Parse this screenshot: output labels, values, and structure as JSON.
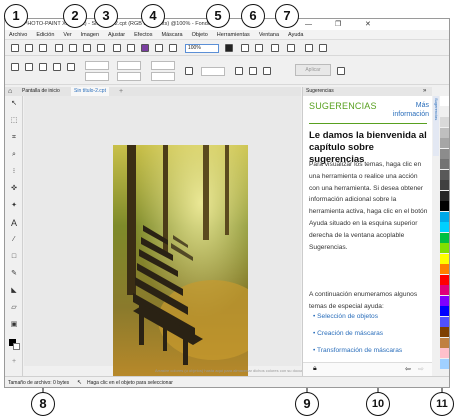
{
  "window": {
    "title": "Corel PHOTO-PAINT X8 (64Bit) - Sin título-2.cpt (RGB de 24 bits) @100% - Fondo"
  },
  "menu": [
    "Archivo",
    "Edición",
    "Ver",
    "Imagen",
    "Ajustar",
    "Efectos",
    "Máscara",
    "Objeto",
    "Herramientas",
    "Ventana",
    "Ayuda"
  ],
  "toolbar": {
    "zoom_value": "100%",
    "apply_label": "Aplicar"
  },
  "tabs": [
    {
      "label": "Pantalla de inicio"
    },
    {
      "label": "Sin título-2.cpt"
    }
  ],
  "canvas": {
    "hint": "Arrastre colores (u objetos) hasta aquí para almacenar dichos colores con su documento"
  },
  "docker": {
    "header": "Sugerencias",
    "section": "SUGERENCIAS",
    "more_info": "Más información",
    "title": "Le damos la bienvenida al capítulo sobre sugerencias",
    "body": "Para visualizar los temas, haga clic en una herramienta o realice una acción con una herramienta. Si desea obtener información adicional sobre la herramienta activa, haga clic en el botón Ayuda situado en la esquina superior derecha de la ventana acoplable Sugerencias.",
    "intro": "A continuación enumeramos algunos temas de especial ayuda:",
    "links": [
      "Selección de objetos",
      "Creación de máscaras",
      "Transformación de máscaras"
    ]
  },
  "vertical_tab": "Sugerencias",
  "status": {
    "size": "Tamaño de archivo: 0 bytes",
    "message": "Haga clic en el objeto para seleccionar"
  },
  "palette_colors": [
    "#ffffff",
    "#f0f0f0",
    "#d9d9d9",
    "#bfbfbf",
    "#a6a6a6",
    "#8c8c8c",
    "#737373",
    "#595959",
    "#404040",
    "#262626",
    "#000000",
    "#00a8e8",
    "#00d0ff",
    "#00c040",
    "#80e000",
    "#ffff00",
    "#ff8000",
    "#ff0000",
    "#e0007a",
    "#8000ff",
    "#0000ff",
    "#5050ff",
    "#7f3f00",
    "#c08040",
    "#ffc0cb",
    "#a0d0ff"
  ],
  "callouts": [
    "1",
    "2",
    "3",
    "4",
    "5",
    "6",
    "7",
    "8",
    "9",
    "10",
    "11"
  ]
}
